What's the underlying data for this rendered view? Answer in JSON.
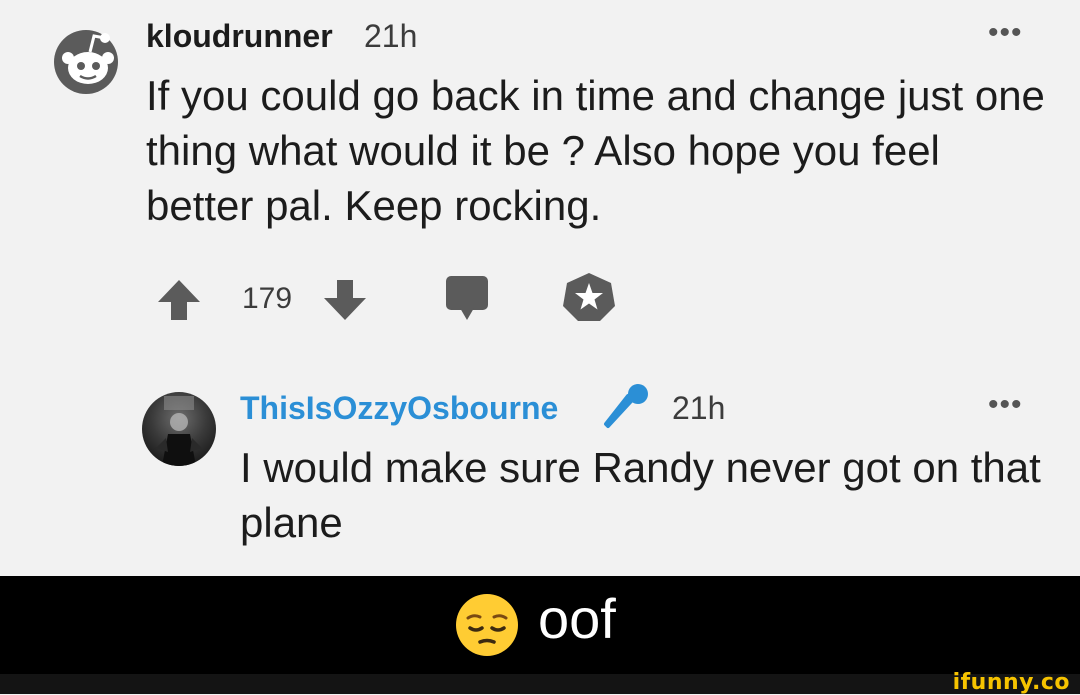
{
  "comment": {
    "username": "kloudrunner",
    "time": "21h",
    "more": "•••",
    "body": "If you could go back in time and change just one thing what would it be ? Also hope you feel better pal. Keep rocking.",
    "score": "179"
  },
  "reply": {
    "username": "ThisIsOzzyOsbourne",
    "time": "21h",
    "more": "•••",
    "body": "I would make sure Randy never got on that plane"
  },
  "caption": {
    "text": "oof"
  },
  "watermark": "ifunny.co",
  "colors": {
    "background": "#f2f2f2",
    "username_link": "#2b8fd6",
    "icon_gray": "#5b5b5b",
    "caption_band": "#000000",
    "watermark": "#f6c300"
  },
  "icons": [
    "reddit-snoo-avatar-icon",
    "upvote-arrow-icon",
    "downvote-arrow-icon",
    "comment-reply-icon",
    "award-icon",
    "microphone-flair-icon",
    "pensive-face-emoji-icon"
  ]
}
